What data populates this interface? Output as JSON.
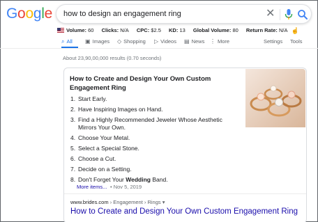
{
  "logo": {
    "text": "Google",
    "letters": [
      "G",
      "o",
      "o",
      "g",
      "l",
      "e"
    ],
    "colors": [
      "#4285F4",
      "#EA4335",
      "#FBBC05",
      "#4285F4",
      "#34A853",
      "#EA4335"
    ]
  },
  "search": {
    "query": "how to design an engagement ring",
    "clear_icon": "close-icon",
    "mic_icon": "microphone-icon",
    "search_icon": "search-icon"
  },
  "keywords": {
    "flag": "us-flag-icon",
    "volume_label": "Volume:",
    "volume_value": "60",
    "clicks_label": "Clicks:",
    "clicks_value": "N/A",
    "cpc_label": "CPC:",
    "cpc_value": "$2.5",
    "kd_label": "KD:",
    "kd_value": "13",
    "global_label": "Global Volume:",
    "global_value": "80",
    "return_label": "Return Rate:",
    "return_value": "N/A"
  },
  "tabs": [
    {
      "label": "All",
      "icon": "magnifier-icon",
      "active": true
    },
    {
      "label": "Images",
      "icon": "image-icon"
    },
    {
      "label": "Shopping",
      "icon": "tag-icon"
    },
    {
      "label": "Videos",
      "icon": "video-icon"
    },
    {
      "label": "News",
      "icon": "news-icon"
    },
    {
      "label": "More",
      "icon": "more-vert-icon"
    }
  ],
  "tools": {
    "settings": "Settings",
    "tools": "Tools"
  },
  "results_stats": "About 23,90,00,000 results (0.70 seconds)",
  "snippet": {
    "title": "How to Create and Design Your Own Custom Engagement Ring",
    "steps": [
      {
        "num": "1.",
        "text": "Start Early."
      },
      {
        "num": "2.",
        "text": "Have Inspiring Images on Hand."
      },
      {
        "num": "3.",
        "text": "Find a Highly Recommended Jeweler Whose Aesthetic Mirrors Your Own."
      },
      {
        "num": "4.",
        "text": "Choose Your Metal."
      },
      {
        "num": "5.",
        "text": "Select a Special Stone."
      },
      {
        "num": "6.",
        "text": "Choose a Cut."
      },
      {
        "num": "7.",
        "text": "Decide on a Setting."
      },
      {
        "num": "8.",
        "pre": "Don't Forget Your ",
        "bold": "Wedding",
        "post": " Band."
      }
    ],
    "more_items": "More items...",
    "date": "• Nov 5, 2019",
    "image": "engagement-rings-photo"
  },
  "result": {
    "domain": "www.brides.com",
    "path": " › Engagement › Rings",
    "path_chevron": "▾",
    "title": "How to Create and Design Your Own Custom Engagement Ring"
  }
}
